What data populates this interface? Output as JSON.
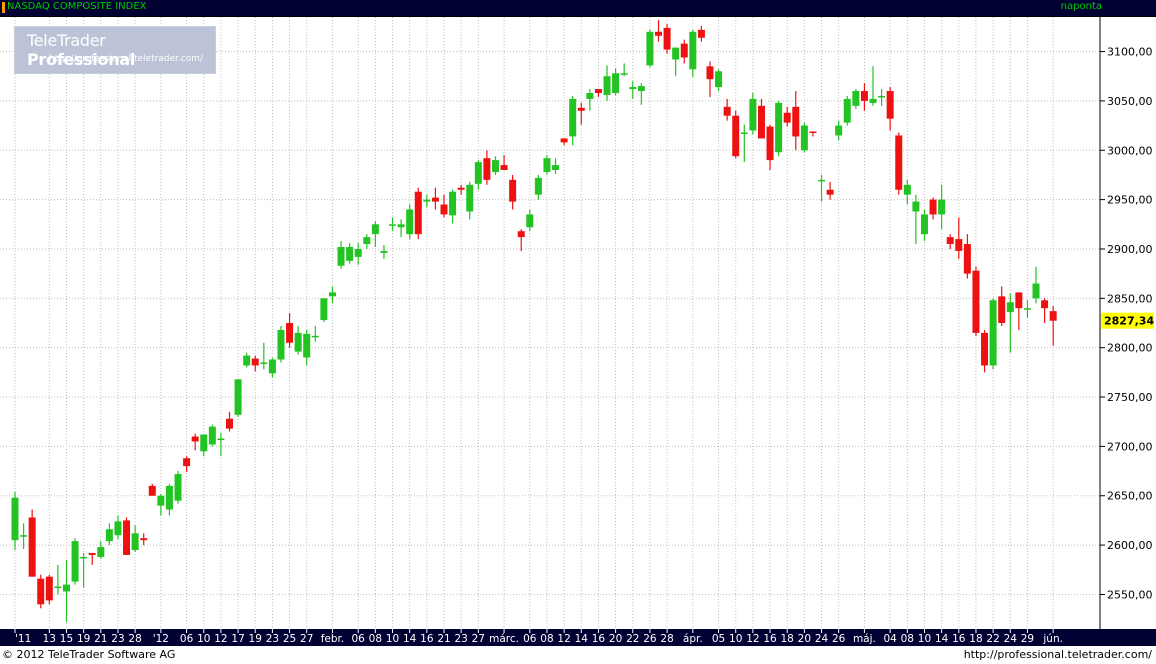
{
  "header": {
    "title": "NASDAQ COMPOSITE INDEX",
    "period": "naponta"
  },
  "logo": {
    "brand_a": "TeleTrader ",
    "brand_b": "Professional",
    "url": "http://professional.teletrader.com/"
  },
  "footer": {
    "copyright": "© 2012 TeleTrader Software AG",
    "url": "http://professional.teletrader.com/"
  },
  "colors": {
    "up": "#22c322",
    "down": "#ee1111",
    "axis_bg": "#000033",
    "grid": "#bfbfbf",
    "last_price_bg": "#ffff00"
  },
  "chart_data": {
    "type": "candlestick",
    "ylim": [
      2515,
      3135
    ],
    "y_ticks": [
      2550,
      2600,
      2650,
      2700,
      2750,
      2800,
      2850,
      2900,
      2950,
      3000,
      3050,
      3100
    ],
    "y_tick_labels": [
      "2550,00",
      "2600,00",
      "2650,00",
      "2700,00",
      "2750,00",
      "2800,00",
      "2850,00",
      "2900,00",
      "2950,00",
      "3000,00",
      "3050,00",
      "3100,00"
    ],
    "last_price_label": "2827,34",
    "last_price": 2827.34,
    "x_labels": [
      "'11",
      "13",
      "15",
      "19",
      "21",
      "23",
      "28",
      "'12",
      "06",
      "10",
      "12",
      "17",
      "19",
      "23",
      "25",
      "27",
      "febr.",
      "06",
      "08",
      "10",
      "14",
      "16",
      "21",
      "23",
      "27",
      "márc.",
      "06",
      "08",
      "12",
      "14",
      "16",
      "20",
      "22",
      "26",
      "28",
      "ápr.",
      "05",
      "10",
      "12",
      "16",
      "18",
      "20",
      "24",
      "26",
      "máj.",
      "04",
      "08",
      "10",
      "14",
      "16",
      "18",
      "22",
      "24",
      "29",
      "jún."
    ],
    "x_label_slot": [
      0,
      4,
      6,
      8,
      10,
      12,
      14,
      17,
      20,
      22,
      24,
      26,
      28,
      30,
      32,
      34,
      37,
      40,
      42,
      44,
      46,
      48,
      50,
      52,
      54,
      57,
      60,
      62,
      64,
      66,
      68,
      70,
      72,
      74,
      76,
      79,
      82,
      84,
      86,
      88,
      90,
      92,
      94,
      96,
      99,
      102,
      104,
      106,
      108,
      110,
      112,
      114,
      116,
      118,
      121
    ],
    "candles": [
      {
        "o": 2605,
        "h": 2654,
        "l": 2595,
        "c": 2648
      },
      {
        "o": 2610,
        "h": 2622,
        "l": 2596,
        "c": 2610
      },
      {
        "o": 2628,
        "h": 2636,
        "l": 2568,
        "c": 2568
      },
      {
        "o": 2566,
        "h": 2570,
        "l": 2536,
        "c": 2540
      },
      {
        "o": 2568,
        "h": 2570,
        "l": 2540,
        "c": 2544
      },
      {
        "o": 2558,
        "h": 2580,
        "l": 2550,
        "c": 2558
      },
      {
        "o": 2553,
        "h": 2585,
        "l": 2522,
        "c": 2560
      },
      {
        "o": 2563,
        "h": 2607,
        "l": 2560,
        "c": 2604
      },
      {
        "o": 2588,
        "h": 2592,
        "l": 2557,
        "c": 2588
      },
      {
        "o": 2592,
        "h": 2592,
        "l": 2580,
        "c": 2590
      },
      {
        "o": 2588,
        "h": 2604,
        "l": 2586,
        "c": 2598
      },
      {
        "o": 2604,
        "h": 2622,
        "l": 2600,
        "c": 2616
      },
      {
        "o": 2610,
        "h": 2630,
        "l": 2606,
        "c": 2624
      },
      {
        "o": 2625,
        "h": 2628,
        "l": 2590,
        "c": 2590
      },
      {
        "o": 2595,
        "h": 2620,
        "l": 2593,
        "c": 2612
      },
      {
        "o": 2607,
        "h": 2612,
        "l": 2600,
        "c": 2605
      },
      {
        "o": 2660,
        "h": 2662,
        "l": 2650,
        "c": 2650
      },
      {
        "o": 2640,
        "h": 2652,
        "l": 2630,
        "c": 2650
      },
      {
        "o": 2636,
        "h": 2662,
        "l": 2630,
        "c": 2660
      },
      {
        "o": 2645,
        "h": 2675,
        "l": 2642,
        "c": 2672
      },
      {
        "o": 2688,
        "h": 2690,
        "l": 2674,
        "c": 2680
      },
      {
        "o": 2710,
        "h": 2713,
        "l": 2696,
        "c": 2705
      },
      {
        "o": 2695,
        "h": 2712,
        "l": 2690,
        "c": 2712
      },
      {
        "o": 2702,
        "h": 2722,
        "l": 2700,
        "c": 2720
      },
      {
        "o": 2708,
        "h": 2714,
        "l": 2690,
        "c": 2708
      },
      {
        "o": 2728,
        "h": 2735,
        "l": 2715,
        "c": 2718
      },
      {
        "o": 2732,
        "h": 2768,
        "l": 2730,
        "c": 2768
      },
      {
        "o": 2782,
        "h": 2795,
        "l": 2780,
        "c": 2792
      },
      {
        "o": 2789,
        "h": 2792,
        "l": 2776,
        "c": 2782
      },
      {
        "o": 2785,
        "h": 2805,
        "l": 2778,
        "c": 2785
      },
      {
        "o": 2774,
        "h": 2790,
        "l": 2770,
        "c": 2788
      },
      {
        "o": 2788,
        "h": 2822,
        "l": 2785,
        "c": 2818
      },
      {
        "o": 2825,
        "h": 2835,
        "l": 2800,
        "c": 2805
      },
      {
        "o": 2796,
        "h": 2822,
        "l": 2793,
        "c": 2815
      },
      {
        "o": 2790,
        "h": 2818,
        "l": 2782,
        "c": 2814
      },
      {
        "o": 2812,
        "h": 2822,
        "l": 2806,
        "c": 2812
      },
      {
        "o": 2828,
        "h": 2850,
        "l": 2826,
        "c": 2850
      },
      {
        "o": 2852,
        "h": 2862,
        "l": 2845,
        "c": 2856
      },
      {
        "o": 2883,
        "h": 2908,
        "l": 2880,
        "c": 2902
      },
      {
        "o": 2888,
        "h": 2906,
        "l": 2885,
        "c": 2902
      },
      {
        "o": 2892,
        "h": 2906,
        "l": 2884,
        "c": 2900
      },
      {
        "o": 2905,
        "h": 2915,
        "l": 2900,
        "c": 2912
      },
      {
        "o": 2915,
        "h": 2928,
        "l": 2902,
        "c": 2925
      },
      {
        "o": 2896,
        "h": 2904,
        "l": 2890,
        "c": 2898
      },
      {
        "o": 2925,
        "h": 2932,
        "l": 2918,
        "c": 2925
      },
      {
        "o": 2922,
        "h": 2930,
        "l": 2912,
        "c": 2925
      },
      {
        "o": 2915,
        "h": 2945,
        "l": 2910,
        "c": 2940
      },
      {
        "o": 2958,
        "h": 2962,
        "l": 2910,
        "c": 2915
      },
      {
        "o": 2948,
        "h": 2955,
        "l": 2942,
        "c": 2950
      },
      {
        "o": 2952,
        "h": 2962,
        "l": 2940,
        "c": 2948
      },
      {
        "o": 2945,
        "h": 2955,
        "l": 2932,
        "c": 2935
      },
      {
        "o": 2934,
        "h": 2960,
        "l": 2926,
        "c": 2958
      },
      {
        "o": 2962,
        "h": 2965,
        "l": 2955,
        "c": 2960
      },
      {
        "o": 2938,
        "h": 2968,
        "l": 2930,
        "c": 2965
      },
      {
        "o": 2966,
        "h": 2990,
        "l": 2960,
        "c": 2988
      },
      {
        "o": 2992,
        "h": 3000,
        "l": 2965,
        "c": 2970
      },
      {
        "o": 2978,
        "h": 2994,
        "l": 2975,
        "c": 2990
      },
      {
        "o": 2985,
        "h": 2995,
        "l": 2980,
        "c": 2980
      },
      {
        "o": 2970,
        "h": 2975,
        "l": 2940,
        "c": 2948
      },
      {
        "o": 2918,
        "h": 2920,
        "l": 2898,
        "c": 2912
      },
      {
        "o": 2922,
        "h": 2940,
        "l": 2918,
        "c": 2935
      },
      {
        "o": 2955,
        "h": 2975,
        "l": 2950,
        "c": 2972
      },
      {
        "o": 2978,
        "h": 2995,
        "l": 2975,
        "c": 2992
      },
      {
        "o": 2980,
        "h": 2992,
        "l": 2976,
        "c": 2985
      },
      {
        "o": 3012,
        "h": 3012,
        "l": 3005,
        "c": 3008
      },
      {
        "o": 3014,
        "h": 3055,
        "l": 3005,
        "c": 3052
      },
      {
        "o": 3043,
        "h": 3048,
        "l": 3026,
        "c": 3040
      },
      {
        "o": 3052,
        "h": 3062,
        "l": 3040,
        "c": 3058
      },
      {
        "o": 3062,
        "h": 3060,
        "l": 3054,
        "c": 3058
      },
      {
        "o": 3056,
        "h": 3086,
        "l": 3050,
        "c": 3075
      },
      {
        "o": 3058,
        "h": 3083,
        "l": 3056,
        "c": 3078
      },
      {
        "o": 3078,
        "h": 3088,
        "l": 3075,
        "c": 3078
      },
      {
        "o": 3062,
        "h": 3070,
        "l": 3052,
        "c": 3064
      },
      {
        "o": 3060,
        "h": 3068,
        "l": 3046,
        "c": 3065
      },
      {
        "o": 3086,
        "h": 3122,
        "l": 3084,
        "c": 3120
      },
      {
        "o": 3120,
        "h": 3132,
        "l": 3110,
        "c": 3116
      },
      {
        "o": 3124,
        "h": 3128,
        "l": 3098,
        "c": 3102
      },
      {
        "o": 3092,
        "h": 3104,
        "l": 3075,
        "c": 3104
      },
      {
        "o": 3108,
        "h": 3112,
        "l": 3088,
        "c": 3094
      },
      {
        "o": 3082,
        "h": 3122,
        "l": 3074,
        "c": 3120
      },
      {
        "o": 3122,
        "h": 3126,
        "l": 3110,
        "c": 3114
      },
      {
        "o": 3085,
        "h": 3090,
        "l": 3054,
        "c": 3072
      },
      {
        "o": 3064,
        "h": 3082,
        "l": 3060,
        "c": 3080
      },
      {
        "o": 3044,
        "h": 3052,
        "l": 3030,
        "c": 3035
      },
      {
        "o": 3035,
        "h": 3040,
        "l": 2992,
        "c": 2994
      },
      {
        "o": 3018,
        "h": 3026,
        "l": 2988,
        "c": 3018
      },
      {
        "o": 3020,
        "h": 3058,
        "l": 3016,
        "c": 3052
      },
      {
        "o": 3045,
        "h": 3052,
        "l": 3012,
        "c": 3012
      },
      {
        "o": 3024,
        "h": 3026,
        "l": 2980,
        "c": 2990
      },
      {
        "o": 2998,
        "h": 3050,
        "l": 2994,
        "c": 3048
      },
      {
        "o": 3038,
        "h": 3044,
        "l": 3024,
        "c": 3028
      },
      {
        "o": 3044,
        "h": 3060,
        "l": 3000,
        "c": 3014
      },
      {
        "o": 3000,
        "h": 3028,
        "l": 2998,
        "c": 3025
      },
      {
        "o": 3019,
        "h": 3018,
        "l": 3014,
        "c": 3018
      },
      {
        "o": 2970,
        "h": 2975,
        "l": 2948,
        "c": 2970
      },
      {
        "o": 2960,
        "h": 2968,
        "l": 2950,
        "c": 2955
      },
      {
        "o": 3015,
        "h": 3030,
        "l": 3010,
        "c": 3025
      },
      {
        "o": 3028,
        "h": 3055,
        "l": 3025,
        "c": 3052
      },
      {
        "o": 3045,
        "h": 3062,
        "l": 3042,
        "c": 3060
      },
      {
        "o": 3060,
        "h": 3068,
        "l": 3040,
        "c": 3050
      },
      {
        "o": 3048,
        "h": 3085,
        "l": 3045,
        "c": 3052
      },
      {
        "o": 3055,
        "h": 3062,
        "l": 3045,
        "c": 3055
      },
      {
        "o": 3060,
        "h": 3064,
        "l": 3020,
        "c": 3032
      },
      {
        "o": 3015,
        "h": 3018,
        "l": 2955,
        "c": 2960
      },
      {
        "o": 2955,
        "h": 2970,
        "l": 2945,
        "c": 2965
      },
      {
        "o": 2938,
        "h": 2955,
        "l": 2905,
        "c": 2948
      },
      {
        "o": 2915,
        "h": 2940,
        "l": 2908,
        "c": 2935
      },
      {
        "o": 2950,
        "h": 2952,
        "l": 2930,
        "c": 2935
      },
      {
        "o": 2935,
        "h": 2965,
        "l": 2920,
        "c": 2950
      },
      {
        "o": 2912,
        "h": 2915,
        "l": 2900,
        "c": 2905
      },
      {
        "o": 2910,
        "h": 2932,
        "l": 2890,
        "c": 2898
      },
      {
        "o": 2905,
        "h": 2915,
        "l": 2870,
        "c": 2875
      },
      {
        "o": 2878,
        "h": 2882,
        "l": 2812,
        "c": 2815
      },
      {
        "o": 2815,
        "h": 2818,
        "l": 2775,
        "c": 2782
      },
      {
        "o": 2782,
        "h": 2850,
        "l": 2778,
        "c": 2848
      },
      {
        "o": 2852,
        "h": 2862,
        "l": 2822,
        "c": 2825
      },
      {
        "o": 2836,
        "h": 2855,
        "l": 2795,
        "c": 2846
      },
      {
        "o": 2856,
        "h": 2856,
        "l": 2818,
        "c": 2840
      },
      {
        "o": 2840,
        "h": 2848,
        "l": 2830,
        "c": 2840
      },
      {
        "o": 2850,
        "h": 2882,
        "l": 2845,
        "c": 2865
      },
      {
        "o": 2848,
        "h": 2850,
        "l": 2825,
        "c": 2840
      },
      {
        "o": 2837,
        "h": 2842,
        "l": 2802,
        "c": 2827.34
      }
    ]
  }
}
